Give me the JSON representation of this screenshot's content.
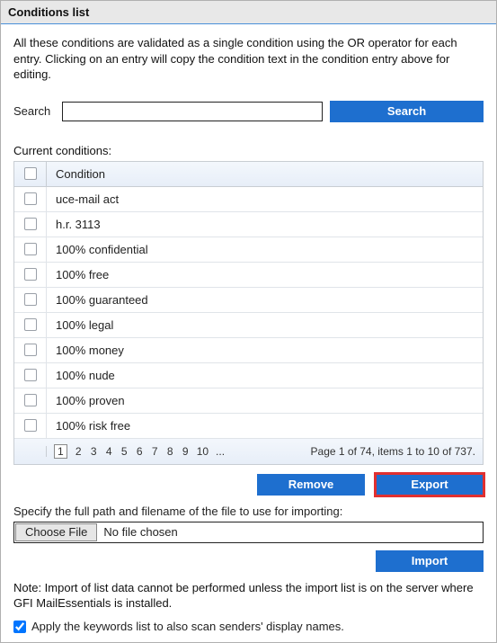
{
  "header": {
    "title": "Conditions list"
  },
  "intro": "All these conditions are validated as a single condition using the OR operator for each entry. Clicking on an entry will copy the condition text in the condition entry above for editing.",
  "search": {
    "label": "Search",
    "value": "",
    "button": "Search"
  },
  "table": {
    "section_label": "Current conditions:",
    "header_col": "Condition",
    "rows": [
      "uce-mail act",
      "h.r. 3113",
      "100% confidential",
      "100% free",
      "100% guaranteed",
      "100% legal",
      "100% money",
      "100% nude",
      "100% proven",
      "100% risk free"
    ],
    "pager": {
      "pages": [
        "1",
        "2",
        "3",
        "4",
        "5",
        "6",
        "7",
        "8",
        "9",
        "10",
        "..."
      ],
      "current": "1",
      "status": "Page 1 of 74, items 1 to 10 of 737."
    }
  },
  "actions": {
    "remove": "Remove",
    "export": "Export"
  },
  "import_section": {
    "label": "Specify the full path and filename of the file to use for importing:",
    "choose": "Choose File",
    "file_text": "No file chosen",
    "import_btn": "Import"
  },
  "note": "Note: Import of list data cannot be performed unless the import list is on the server where GFI MailEssentials is installed.",
  "apply": {
    "checked": true,
    "label": "Apply the keywords list to also scan senders' display names."
  }
}
